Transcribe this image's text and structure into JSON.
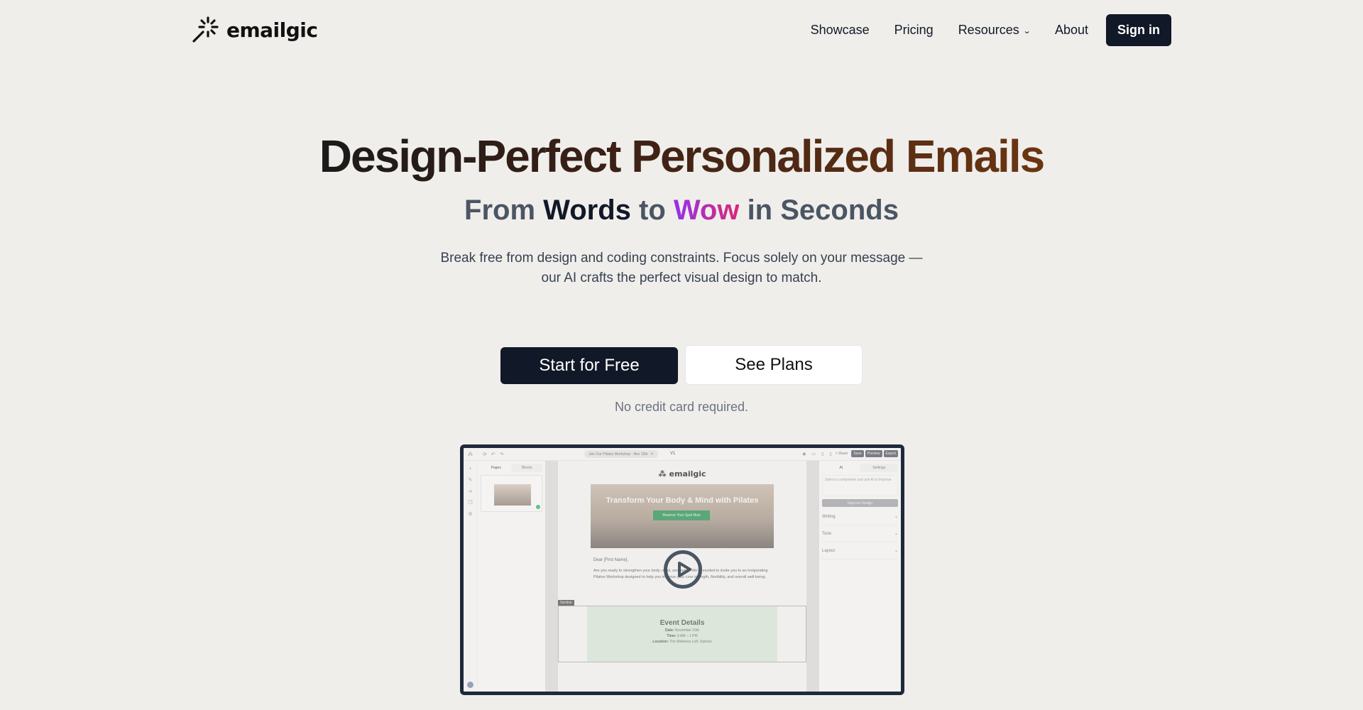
{
  "nav": {
    "brand": "emailgic",
    "links": [
      {
        "label": "Showcase"
      },
      {
        "label": "Pricing"
      },
      {
        "label": "Resources",
        "has_dropdown": true
      },
      {
        "label": "About"
      }
    ],
    "signin_label": "Sign in"
  },
  "hero": {
    "title": "Design-Perfect Personalized Emails",
    "subtitle": {
      "part1": "From ",
      "words": "Words",
      "part2": " to ",
      "wow": "Wow",
      "part3": " in Seconds"
    },
    "description": "Break free from design and coding constraints. Focus solely on your message — our AI crafts the perfect visual design to match.",
    "primary_cta": "Start for Free",
    "secondary_cta": "See Plans",
    "note": "No credit card required."
  },
  "colors": {
    "primary": "#111827",
    "background": "#f0eeeb",
    "title_gradient_end": "#6b3512",
    "wow_gradient": [
      "#9333ea",
      "#db2777"
    ],
    "frame_border": "#1e293b"
  },
  "app_preview": {
    "email_title": "Join Our Pilates Workshop - Nov 15th",
    "version": "V1",
    "toolbar": {
      "share": "Share",
      "save": "Save",
      "preview": "Preview",
      "export": "Export"
    },
    "left_tabs": {
      "pages": "Pages",
      "blocks": "Blocks"
    },
    "right_tabs": {
      "ai": "AI",
      "settings": "Settings"
    },
    "ai_placeholder": "Select a component and ask AI to improve",
    "improve_button": "Improve Design",
    "accordions": [
      "Writing",
      "Tone",
      "Layout"
    ],
    "email": {
      "brand": "emailgic",
      "hero_title": "Transform Your Body & Mind with Pilates",
      "hero_button": "Reserve Your Spot Now",
      "greeting": "Dear [First Name],",
      "body": "Are you ready to strengthen your body, mind, and spirit? We're excited to invite you to an invigorating Pilates Workshop designed to help you improve your core strength, flexibility, and overall well-being.",
      "section_tag": "Section",
      "event_title": "Event Details",
      "event_date_label": "Date:",
      "event_date": " November 15th",
      "event_time_label": "Time:",
      "event_time": " 9 AM – 1 PM",
      "event_location_label": "Location:",
      "event_location": " The Wellness Loft, Uptown"
    }
  }
}
